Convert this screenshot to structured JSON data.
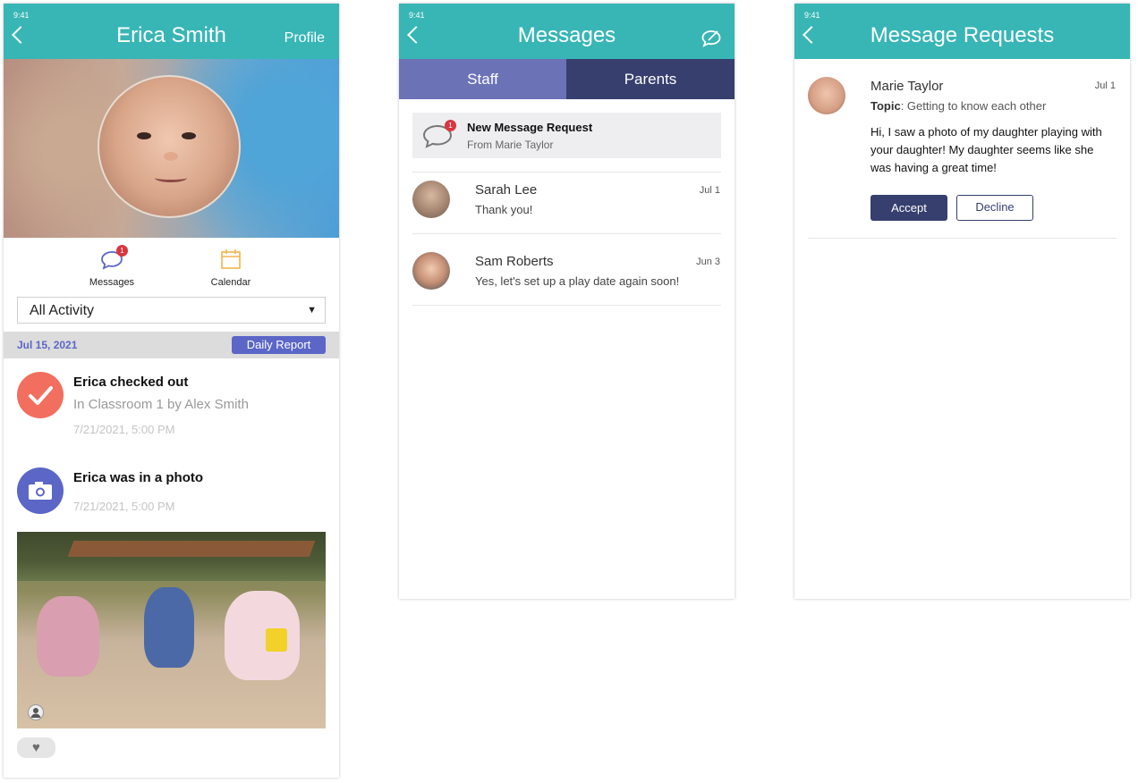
{
  "status_time": "9:41",
  "profile": {
    "title": "Erica Smith",
    "profile_link": "Profile",
    "quicklinks": [
      {
        "label": "Messages",
        "badge": "1"
      },
      {
        "label": "Calendar"
      }
    ],
    "filter_value": "All Activity",
    "date": "Jul 15, 2021",
    "daily_report_label": "Daily Report",
    "activities": [
      {
        "title": "Erica checked out",
        "subtitle": "In Classroom 1 by Alex Smith",
        "time": "7/21/2021, 5:00 PM",
        "icon": "checkmark-icon"
      },
      {
        "title": "Erica was in a photo",
        "time": "7/21/2021, 5:00 PM",
        "icon": "camera-icon"
      }
    ],
    "like_icon": "heart-icon"
  },
  "messages": {
    "title": "Messages",
    "tabs": [
      {
        "label": "Staff"
      },
      {
        "label": "Parents"
      }
    ],
    "request": {
      "title": "New Message Request",
      "from": "From Marie Taylor",
      "badge": "1"
    },
    "conversations": [
      {
        "name": "Sarah Lee",
        "text": "Thank you!",
        "date": "Jul 1"
      },
      {
        "name": "Sam Roberts",
        "text": "Yes, let's set up a play date again soon!",
        "date": "Jun 3"
      }
    ]
  },
  "requests": {
    "title": "Message Requests",
    "item": {
      "name": "Marie Taylor",
      "date": "Jul 1",
      "topic_label": "Topic",
      "topic": ": Getting to know each other",
      "body": "Hi, I saw a photo of my daughter playing with your daughter! My daughter seems like she was having a great time!",
      "accept_label": "Accept",
      "decline_label": "Decline"
    }
  },
  "colors": {
    "teal": "#38b6b5",
    "indigo": "#363f6e",
    "periwinkle": "#6b72b6",
    "accent_blue": "#5b66c7",
    "check_red": "#f26e5e",
    "camera_purple": "#5b66c7",
    "badge_red": "#d9363e"
  }
}
